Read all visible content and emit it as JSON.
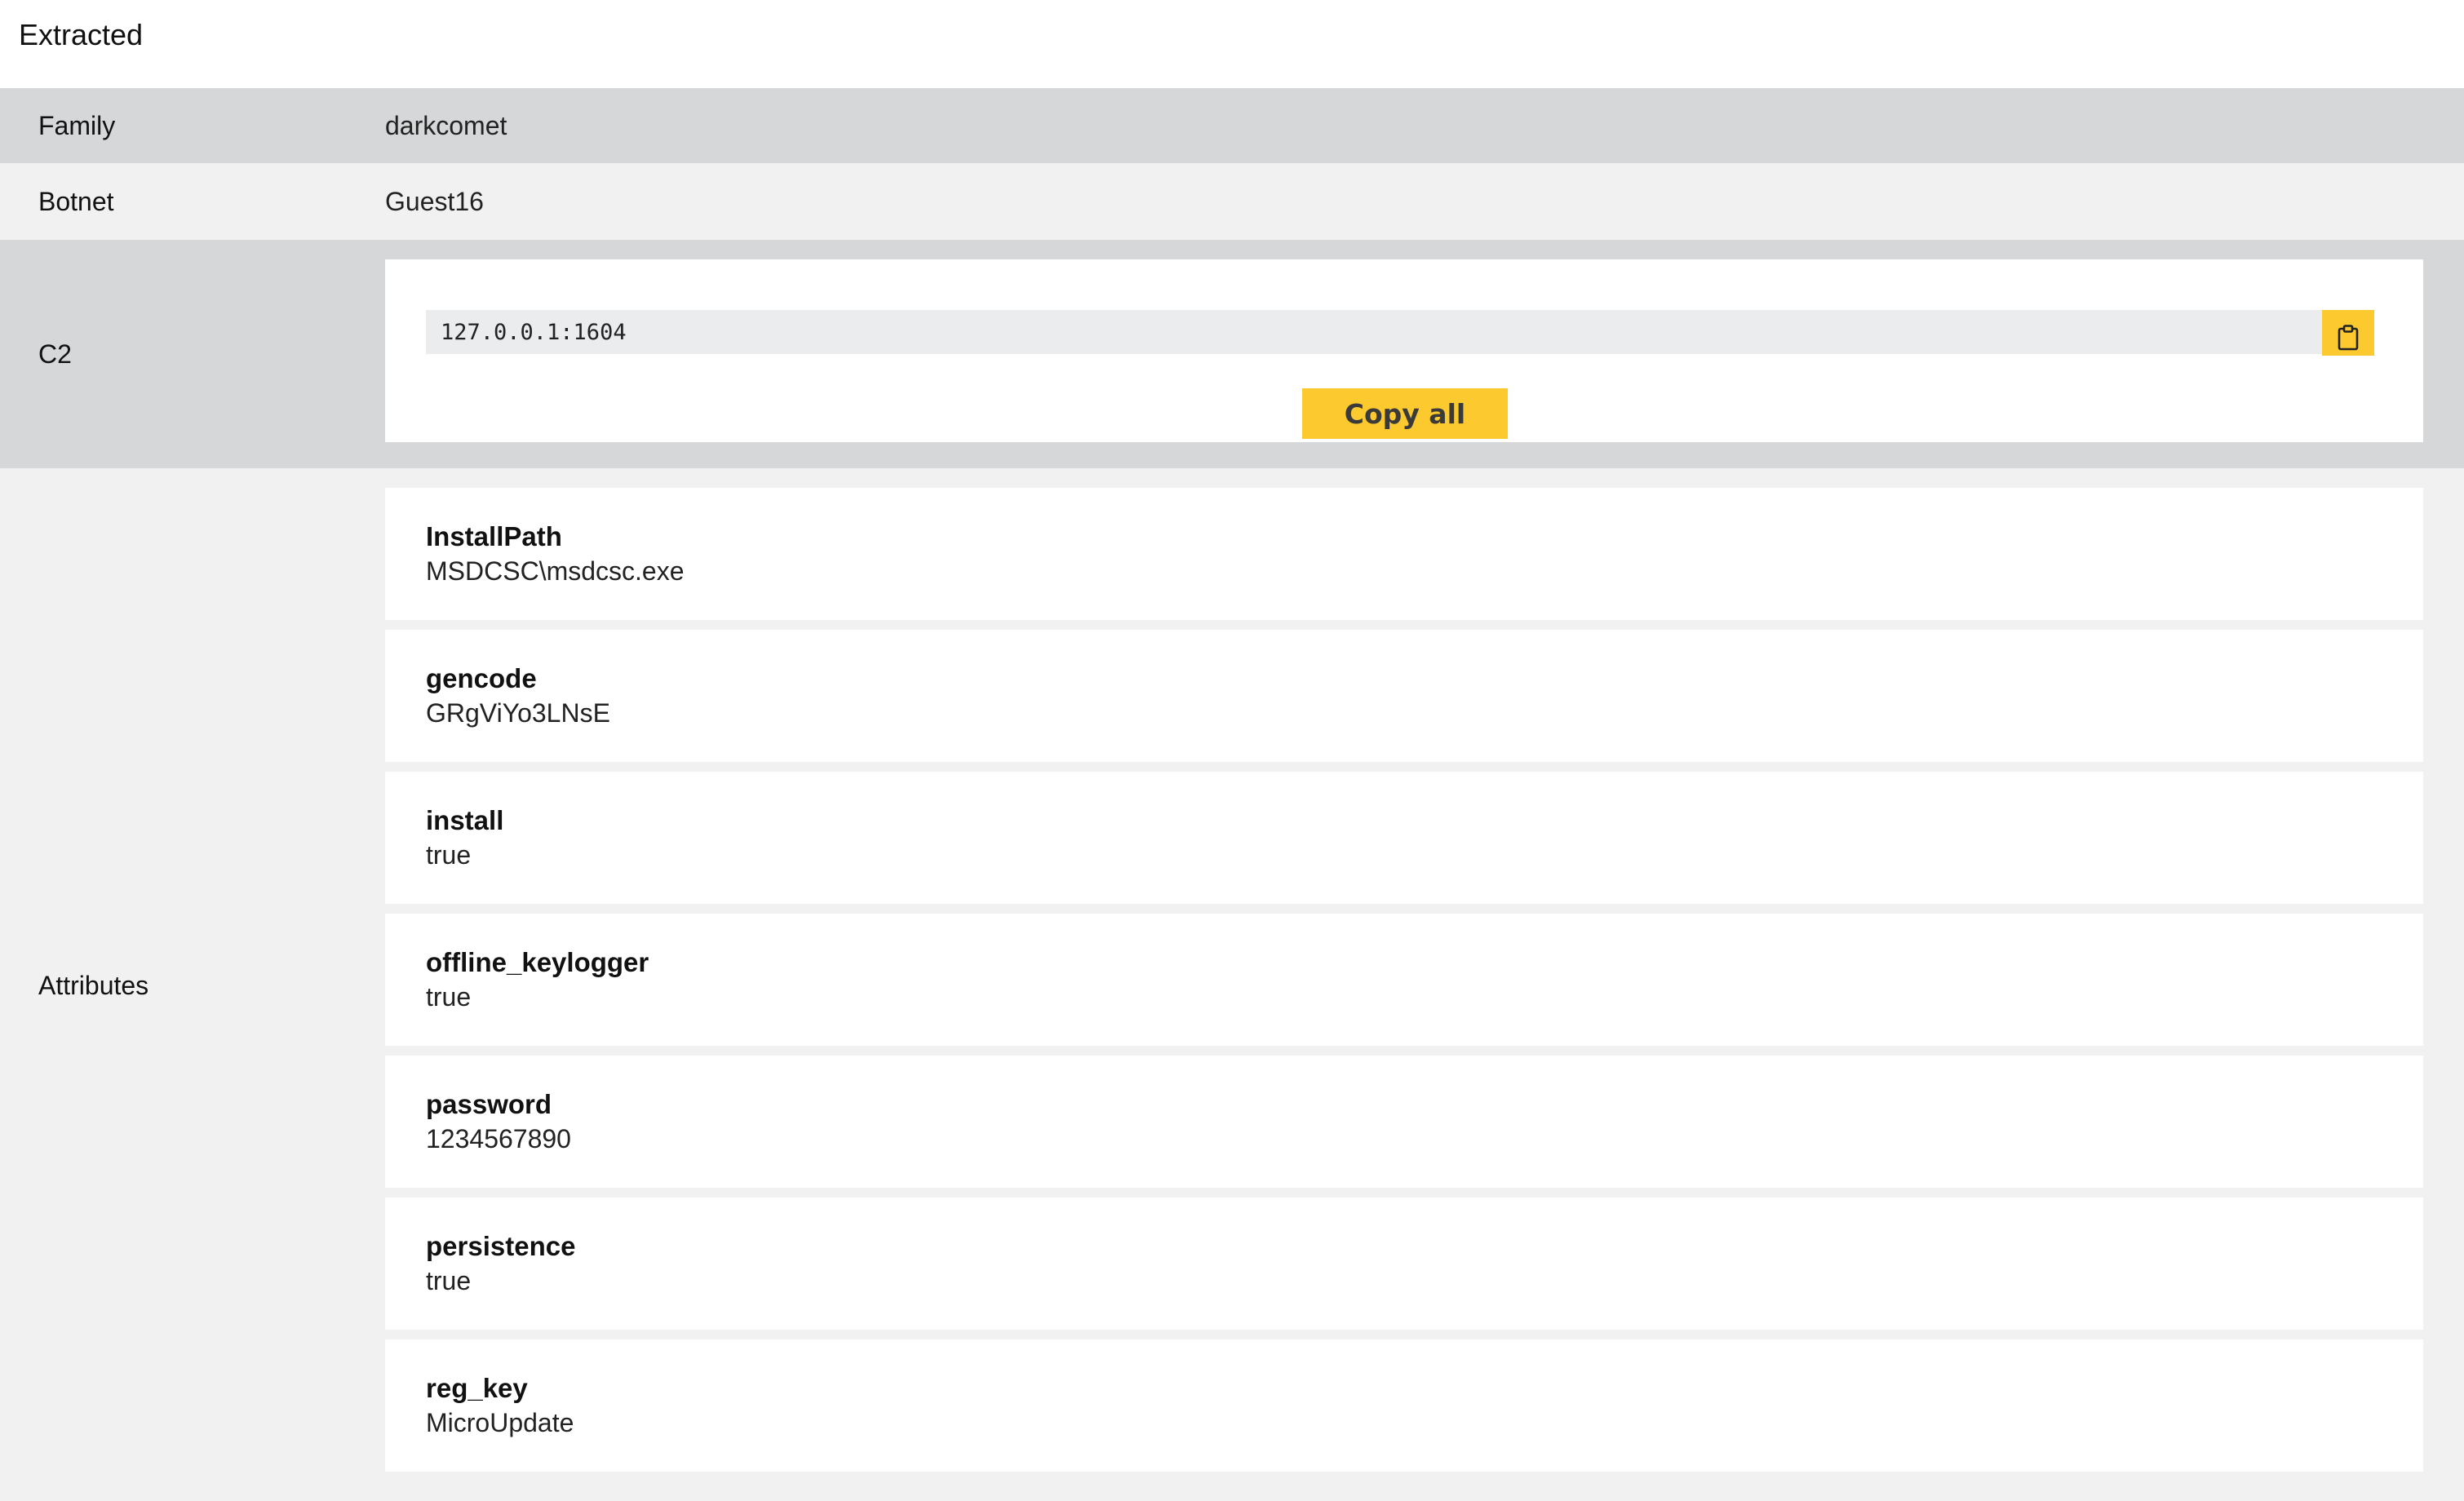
{
  "section_title": "Extracted",
  "family": {
    "label": "Family",
    "value": "darkcomet"
  },
  "botnet": {
    "label": "Botnet",
    "value": "Guest16"
  },
  "c2": {
    "label": "C2",
    "address": "127.0.0.1:1604",
    "copy_icon": "clipboard-icon",
    "copy_all_label": "Copy all"
  },
  "attributes": {
    "label": "Attributes",
    "items": [
      {
        "key": "InstallPath",
        "value": "MSDCSC\\msdcsc.exe"
      },
      {
        "key": "gencode",
        "value": "GRgViYo3LNsE"
      },
      {
        "key": "install",
        "value": "true"
      },
      {
        "key": "offline_keylogger",
        "value": "true"
      },
      {
        "key": "password",
        "value": "1234567890"
      },
      {
        "key": "persistence",
        "value": "true"
      },
      {
        "key": "reg_key",
        "value": "MicroUpdate"
      }
    ]
  },
  "colors": {
    "accent": "#fcca2e",
    "row_dark": "#d6d7d8",
    "row_light": "#f1f1f1",
    "input_bg": "#ebeced"
  }
}
